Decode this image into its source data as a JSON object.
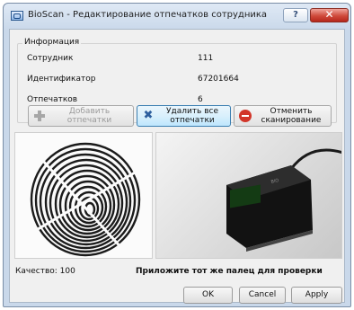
{
  "window": {
    "title": "BioScan - Редактирование отпечатков сотрудника",
    "help_label": "?",
    "close_label": "✕"
  },
  "info": {
    "group_title": "Информация",
    "rows": [
      {
        "label": "Сотрудник",
        "value": "111"
      },
      {
        "label": "Идентификатор",
        "value": "67201664"
      },
      {
        "label": "Отпечатков",
        "value": "6"
      }
    ]
  },
  "actions": {
    "add_label_1": "Добавить",
    "add_label_2": "отпечатки",
    "delete_label_1": "Удалить все",
    "delete_label_2": "отпечатки",
    "cancel_label_1": "Отменить",
    "cancel_label_2": "сканирование"
  },
  "status": {
    "quality": "Качество: 100",
    "instruction": "Приложите тот же палец для проверки"
  },
  "dialog": {
    "ok": "OK",
    "cancel": "Cancel",
    "apply": "Apply"
  },
  "colors": {
    "title_bar": "#c9d8ea",
    "close_button": "#cf4a3b",
    "active_button": "#bee6fd",
    "client_bg": "#f0f0f0"
  },
  "icons": [
    "app-icon",
    "help-icon",
    "close-icon",
    "plus-icon",
    "x-icon",
    "stop-icon"
  ]
}
